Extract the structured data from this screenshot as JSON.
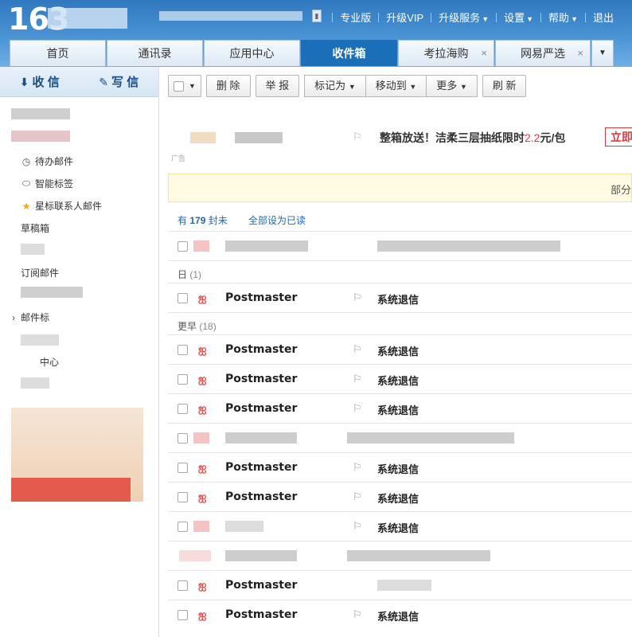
{
  "header": {
    "logo": "163",
    "links": [
      {
        "label": "专业版",
        "dropdown": false
      },
      {
        "label": "升级VIP",
        "dropdown": false
      },
      {
        "label": "升级服务",
        "dropdown": true
      },
      {
        "label": "设置",
        "dropdown": true
      },
      {
        "label": "帮助",
        "dropdown": true
      },
      {
        "label": "退出",
        "dropdown": false
      }
    ],
    "tabs": [
      {
        "label": "首页",
        "active": false,
        "closable": false
      },
      {
        "label": "通讯录",
        "active": false,
        "closable": false
      },
      {
        "label": "应用中心",
        "active": false,
        "closable": false
      },
      {
        "label": "收件箱",
        "active": true,
        "closable": false
      },
      {
        "label": "考拉海购",
        "active": false,
        "closable": true
      },
      {
        "label": "网易严选",
        "active": false,
        "closable": true
      }
    ],
    "accent": "#1a6fb8"
  },
  "sidebar": {
    "receive_label": "收 信",
    "write_label": "写 信",
    "items": {
      "todo": "待办邮件",
      "smart_tags": "智能标签",
      "starred": "星标联系人邮件",
      "drafts": "草稿箱",
      "subscriptions": "订阅邮件",
      "mail_tags": "邮件标",
      "center": "中心"
    }
  },
  "toolbar": {
    "delete": "删 除",
    "report": "举 报",
    "mark_as": "标记为",
    "move_to": "移动到",
    "more": "更多",
    "refresh": "刷 新"
  },
  "ad": {
    "tag": "广告",
    "text_before": "整箱放送！洁柔三层抽纸限时",
    "price": "2.2",
    "text_after": "元/包",
    "cta": "立即"
  },
  "notice": {
    "text": "部分"
  },
  "summary": {
    "count_prefix": "有",
    "count": "179",
    "count_suffix": "封未",
    "mark_all_read": "全部设为已读"
  },
  "groups": [
    {
      "label": "日",
      "count": "(1)"
    },
    {
      "label": "更早",
      "count": "(18)"
    }
  ],
  "mail": {
    "sender": "Postmaster",
    "subject": "系统退信"
  }
}
